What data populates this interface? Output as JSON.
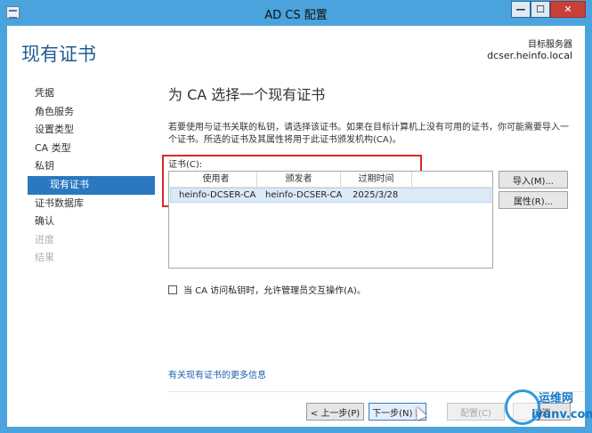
{
  "window": {
    "title": "AD CS 配置",
    "min": "—",
    "max": "☐",
    "close": "✕"
  },
  "page": {
    "title": "现有证书",
    "target_server_label": "目标服务器",
    "target_server_value": "dcser.heinfo.local"
  },
  "nav": [
    {
      "label": "凭据",
      "state": "normal"
    },
    {
      "label": "角色服务",
      "state": "normal"
    },
    {
      "label": "设置类型",
      "state": "normal"
    },
    {
      "label": "CA 类型",
      "state": "normal"
    },
    {
      "label": "私钥",
      "state": "normal"
    },
    {
      "label": "现有证书",
      "state": "active"
    },
    {
      "label": "证书数据库",
      "state": "normal"
    },
    {
      "label": "确认",
      "state": "normal"
    },
    {
      "label": "进度",
      "state": "disabled"
    },
    {
      "label": "结果",
      "state": "disabled"
    }
  ],
  "main": {
    "heading": "为 CA 选择一个现有证书",
    "description": "若要使用与证书关联的私钥，请选择该证书。如果在目标计算机上没有可用的证书，你可能需要导入一个证书。所选的证书及其属性将用于此证书颁发机构(CA)。",
    "cert_label": "证书(C):",
    "columns": [
      "使用者",
      "颁发者",
      "过期时间"
    ],
    "rows": [
      {
        "subject": "heinfo-DCSER-CA",
        "issuer": "heinfo-DCSER-CA",
        "expires": "2025/3/28"
      }
    ],
    "import_button": "导入(M)...",
    "properties_button": "属性(R)...",
    "checkbox_label": "当 CA 访问私钥时，允许管理员交互操作(A)。",
    "checkbox_checked": false,
    "more_link": "有关现有证书的更多信息"
  },
  "footer": {
    "prev": "< 上一步(P)",
    "next": "下一步(N) >",
    "configure": "配置(C)",
    "cancel": "取消"
  },
  "watermark": {
    "cn": "运维网",
    "en": "iyunv.com"
  },
  "colors": {
    "accent": "#2a79c0",
    "title": "#1e5d95",
    "highlight": "#d42a2a",
    "frame": "#4aa3dc"
  }
}
